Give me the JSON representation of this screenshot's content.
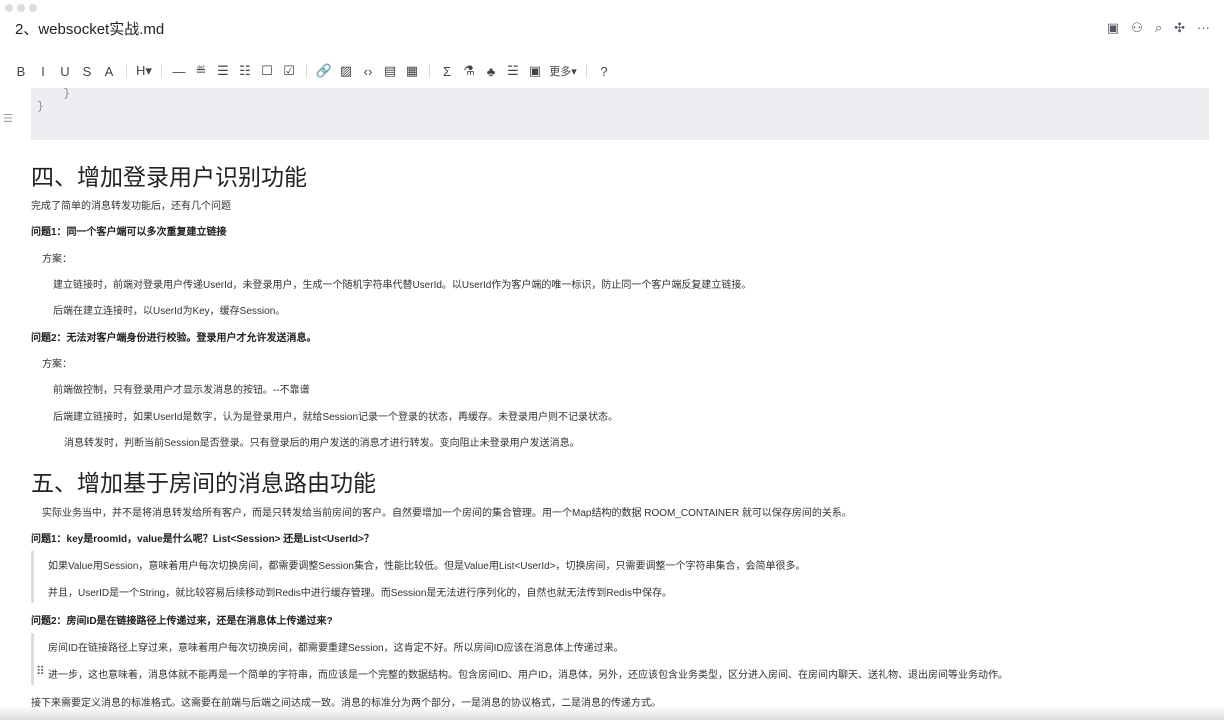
{
  "window": {
    "title": "2、websocket实战.md"
  },
  "header_icons": [
    "outline-icon",
    "share-user-icon",
    "search-replace-icon",
    "mindmap-icon",
    "more-icon"
  ],
  "toolbar": {
    "items": [
      {
        "name": "bold",
        "glyph": "B"
      },
      {
        "name": "italic",
        "glyph": "I"
      },
      {
        "name": "underline",
        "glyph": "U"
      },
      {
        "name": "strikethrough",
        "glyph": "S"
      },
      {
        "name": "highlight",
        "glyph": "A"
      },
      {
        "name": "heading",
        "glyph": "H▾"
      },
      {
        "name": "divider",
        "glyph": "—"
      },
      {
        "name": "blockquote",
        "glyph": "≝"
      },
      {
        "name": "bullet-list",
        "glyph": "☰"
      },
      {
        "name": "ordered-list",
        "glyph": "☷"
      },
      {
        "name": "checkbox",
        "glyph": "☐"
      },
      {
        "name": "task",
        "glyph": "☑"
      },
      {
        "name": "link",
        "glyph": "🔗"
      },
      {
        "name": "image",
        "glyph": "▨"
      },
      {
        "name": "code",
        "glyph": "‹›"
      },
      {
        "name": "code-block",
        "glyph": "▤"
      },
      {
        "name": "table",
        "glyph": "▦"
      },
      {
        "name": "formula",
        "glyph": "Σ"
      },
      {
        "name": "flask",
        "glyph": "⚗"
      },
      {
        "name": "diagram",
        "glyph": "♣"
      },
      {
        "name": "toc",
        "glyph": "☱"
      },
      {
        "name": "template",
        "glyph": "▣"
      }
    ],
    "more_label": "更多▾",
    "help_glyph": "?"
  },
  "code_lines": [
    "    }",
    "}"
  ],
  "content": {
    "h4": "四、增加登录用户识别功能",
    "p1": "完成了简单的消息转发功能后，还有几个问题",
    "q1": "问题1：同一个客户端可以多次重复建立链接",
    "plan1": "方案：",
    "s1a": "建立链接时，前端对登录用户传递UserId，未登录用户，生成一个随机字符串代替UserId。以UserId作为客户端的唯一标识，防止同一个客户端反复建立链接。",
    "s1b": "后端在建立连接时，以UserId为Key，缓存Session。",
    "q2": "问题2：无法对客户端身份进行校验。登录用户才允许发送消息。",
    "plan2": "方案：",
    "s2a": "前端做控制，只有登录用户才显示发消息的按钮。--不靠谱",
    "s2b": "后端建立链接时，如果UserId是数字，认为是登录用户，就给Session记录一个登录的状态，再缓存。未登录用户则不记录状态。",
    "s2c": "消息转发时，判断当前Session是否登录。只有登录后的用户发送的消息才进行转发。变向阻止未登录用户发送消息。",
    "h5": "五、增加基于房间的消息路由功能",
    "p5": "实际业务当中，并不是将消息转发给所有客户，而是只转发给当前房间的客户。自然要增加一个房间的集合管理。用一个Map结构的数据 ROOM_CONTAINER 就可以保存房间的关系。",
    "r1": "问题1：key是roomId，value是什么呢？List<Session> 还是List<UserId>？",
    "r1a": "如果Value用Session，意味着用户每次切换房间，都需要调整Session集合，性能比较低。但是Value用List<UserId>，切换房间，只需要调整一个字符串集合，会简单很多。",
    "r1b": "并且，UserID是一个String，就比较容易后续移动到Redis中进行缓存管理。而Session是无法进行序列化的，自然也就无法传到Redis中保存。",
    "r2": "问题2：房间ID是在链接路径上传递过来，还是在消息体上传递过来?",
    "r2a": "房间ID在链接路径上穿过来，意味着用户每次切换房间，都需要重建Session，这肯定不好。所以房间ID应该在消息体上传递过来。",
    "r2b": "进一步，这也意味着，消息体就不能再是一个简单的字符串，而应该是一个完整的数据结构。包含房间ID、用户ID，消息体，另外，还应该包含业务类型，区分进入房间、在房间内聊天、送礼物、退出房间等业务动作。",
    "last": "接下来需要定义消息的标准格式。这需要在前端与后端之间达成一致。消息的标准分为两个部分，一是消息的协议格式，二是消息的传递方式。"
  }
}
